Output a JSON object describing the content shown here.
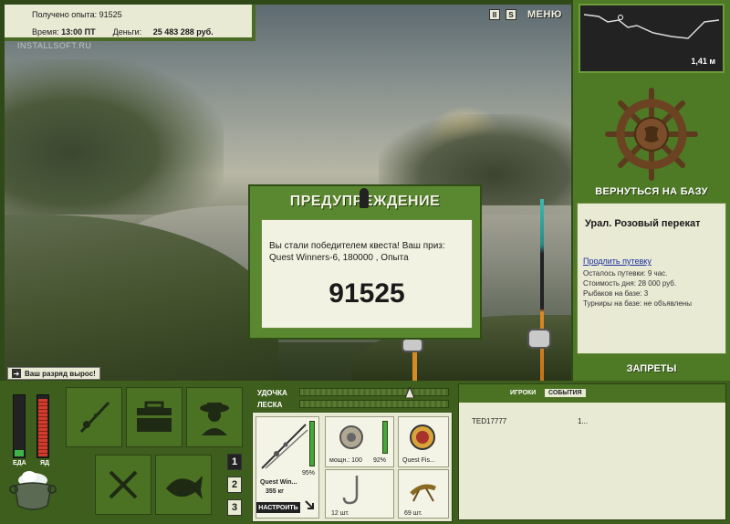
{
  "info": {
    "xp_label": "Получено опыта:",
    "xp_value": "91525",
    "time_label": "Время:",
    "time_value": "13:00 ПТ",
    "money_label": "Деньги:",
    "money_value": "25 483 288 руб."
  },
  "watermark": "INSTALLSOFT.RU",
  "toolbar": {
    "pause_label": "II",
    "s_label": "S",
    "menu_label": "МЕНЮ"
  },
  "rank_msg": "Ваш разряд вырос!",
  "depth": {
    "value": "1,41 м"
  },
  "base": {
    "return_label": "ВЕРНУТЬСЯ НА БАЗУ",
    "location": "Урал. Розовый перекат",
    "extend_link": "Продлить путевку",
    "lines": [
      "Осталось путевки: 9 час.",
      "Стоимость дня: 28 000 руб.",
      "Рыбаков на базе: 3",
      "Турниры на базе: не объявлены"
    ],
    "bans_label": "ЗАПРЕТЫ"
  },
  "dialog": {
    "title": "ПРЕДУПРЕЖДЕНИЕ",
    "message": "Вы стали победителем квеста! Ваш приз: Quest Winners-6, 180000 , Опыта",
    "value": "91525"
  },
  "status": {
    "food_label": "ЕДА",
    "poison_label": "ЯД",
    "food_level": 0.1,
    "poison_level": 0.92
  },
  "pages": [
    "1",
    "2",
    "3"
  ],
  "tackle": {
    "rod_label": "УДОЧКА",
    "line_label": "ЛЕСКА",
    "rod_name": "Quest Win...",
    "rod_weight": "355 кг",
    "rod_percent": "95%",
    "reel_caption": "мощн.: 100",
    "reel_percent": "92%",
    "line_caption": "Quest Fis...",
    "hook_caption": "12 шт.",
    "bait_caption": "69 шт.",
    "setup_label": "НАСТРОИТЬ"
  },
  "events": {
    "tab_players": "ИГРОКИ",
    "tab_events": "СОБЫТИЯ",
    "rows": [
      {
        "name": "TED17777",
        "value": "1..."
      }
    ]
  },
  "colors": {
    "panel_green": "#4e7a26",
    "panel_bg": "#e9ead4",
    "food_fill": "#3db34a",
    "poison_fill": "#d23b2e"
  }
}
